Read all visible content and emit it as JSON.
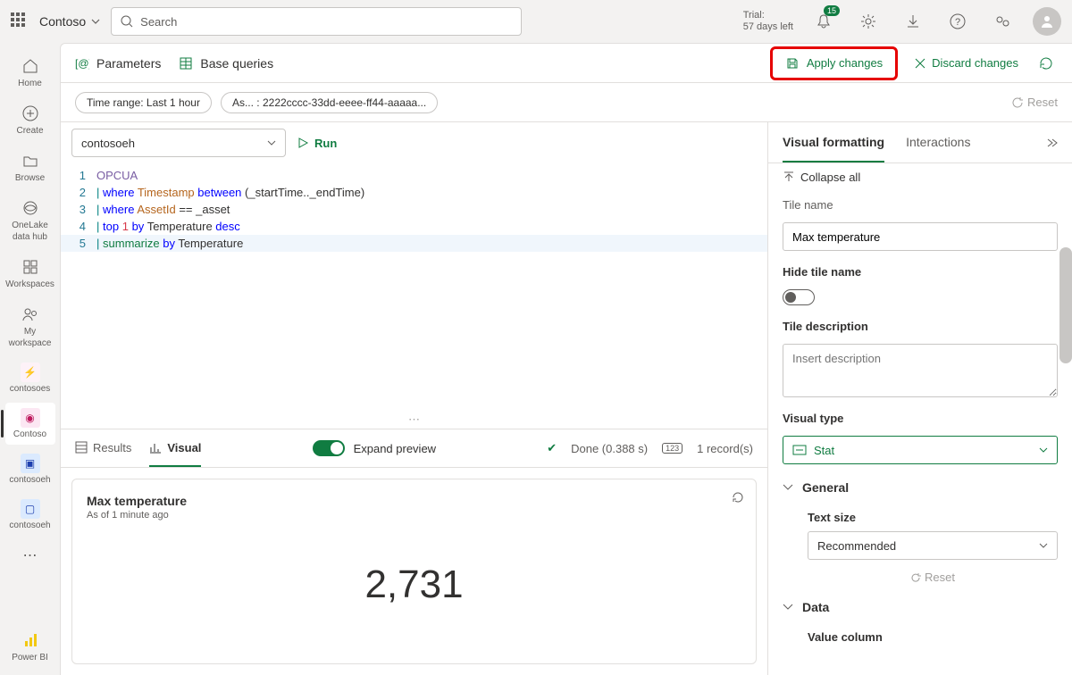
{
  "header": {
    "org": "Contoso",
    "searchPlaceholder": "Search",
    "trialLine1": "Trial:",
    "trialLine2": "57 days left",
    "badge": "15"
  },
  "rail": {
    "home": "Home",
    "create": "Create",
    "browse": "Browse",
    "onelake1": "OneLake",
    "onelake2": "data hub",
    "workspaces": "Workspaces",
    "my1": "My",
    "my2": "workspace",
    "contosoes": "contosoes",
    "contoso": "Contoso",
    "contosoeh1": "contosoeh",
    "contosoeh2": "contosoeh",
    "powerbi": "Power BI"
  },
  "toolbar": {
    "parameters": "Parameters",
    "baseQueries": "Base queries",
    "apply": "Apply changes",
    "discard": "Discard changes"
  },
  "filters": {
    "timeRange": "Time range: Last 1 hour",
    "asset": "As... : 2222cccc-33dd-eeee-ff44-aaaaa...",
    "reset": "Reset"
  },
  "query": {
    "database": "contosoeh",
    "run": "Run",
    "lines": [
      {
        "n": "1",
        "html": "<span class='kw-purple'>OPCUA</span>"
      },
      {
        "n": "2",
        "html": "<span class='kw-teal'>|</span> <span class='kw-blue'>where</span> <span class='kw-orange'>Timestamp</span> <span class='kw-blue'>between</span> (_startTime.._endTime)"
      },
      {
        "n": "3",
        "html": "<span class='kw-teal'>|</span> <span class='kw-blue'>where</span> <span class='kw-orange'>AssetId</span> == _asset"
      },
      {
        "n": "4",
        "html": "<span class='kw-teal'>|</span> <span class='kw-blue'>top</span> <span class='kw-red'>1</span> <span class='kw-blue'>by</span> Temperature <span class='kw-blue'>desc</span>"
      },
      {
        "n": "5",
        "html": "<span class='kw-teal'>|</span> <span class='kw-green'>summarize</span> <span class='kw-blue'>by</span> Temperature",
        "hl": true
      }
    ]
  },
  "results": {
    "tabResults": "Results",
    "tabVisual": "Visual",
    "expandPreview": "Expand preview",
    "done": "Done (0.388 s)",
    "records": "1 record(s)"
  },
  "card": {
    "title": "Max temperature",
    "subtitle": "As of 1 minute ago",
    "value": "2,731"
  },
  "panel": {
    "tabFormatting": "Visual formatting",
    "tabInteractions": "Interactions",
    "collapseAll": "Collapse all",
    "tileName": "Tile name",
    "tileNameValue": "Max temperature",
    "hideTileName": "Hide tile name",
    "tileDesc": "Tile description",
    "descPlaceholder": "Insert description",
    "visualType": "Visual type",
    "visualTypeValue": "Stat",
    "general": "General",
    "textSize": "Text size",
    "textSizeValue": "Recommended",
    "reset": "Reset",
    "data": "Data",
    "valueColumn": "Value column"
  }
}
